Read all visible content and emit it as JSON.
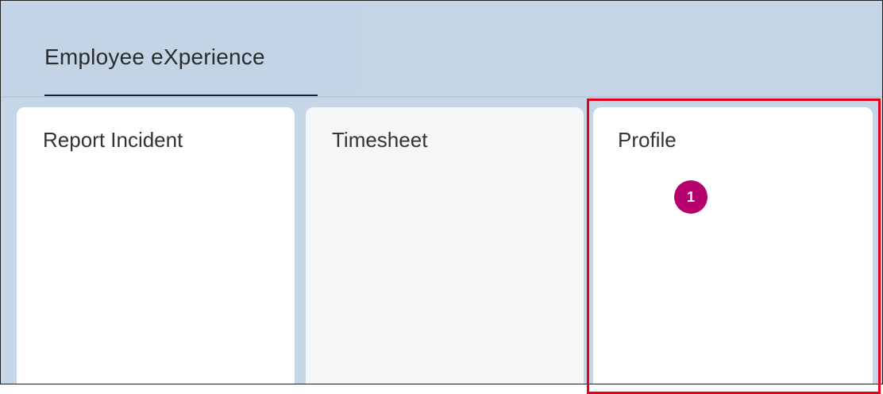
{
  "group": {
    "tab_label": "Employee eXperience"
  },
  "tiles": [
    {
      "title": "Report Incident"
    },
    {
      "title": "Timesheet"
    },
    {
      "title": "Profile"
    }
  ],
  "annotation": {
    "step_number": "1",
    "highlight_color": "#e3001b",
    "badge_color": "#b5006e"
  }
}
